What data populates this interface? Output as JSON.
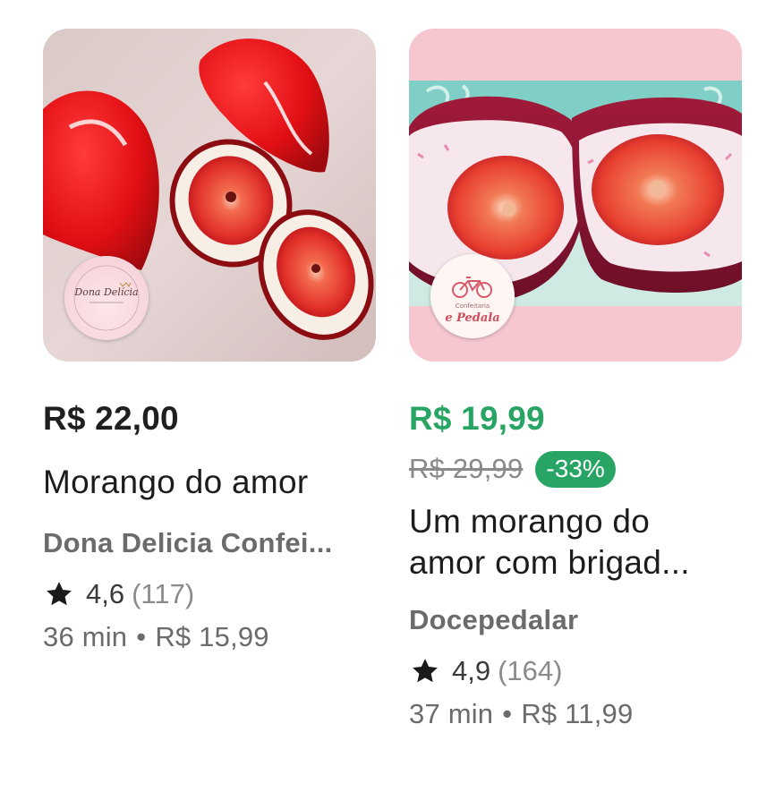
{
  "products": [
    {
      "price": "R$ 22,00",
      "title": "Morango do amor",
      "store": "Dona Delicia Confei...",
      "rating": "4,6",
      "rating_count": "(117)",
      "time": "36 min",
      "separator": "•",
      "delivery_fee": "R$ 15,99",
      "logo_text": "Dona Delícia"
    },
    {
      "price": "R$ 19,99",
      "old_price": "R$ 29,99",
      "discount": "-33%",
      "title_line1": "Um morango do",
      "title_line2": "amor com brigad...",
      "store": "Docepedalar",
      "rating": "4,9",
      "rating_count": "(164)",
      "time": "37 min",
      "separator": "•",
      "delivery_fee": "R$ 11,99",
      "logo_text_small": "Confeitaria",
      "logo_text": "e Pedala"
    }
  ],
  "colors": {
    "discount_green": "#28a564",
    "muted_text": "#6b6b6b",
    "strawberry_red": "#e41218"
  },
  "icons": {
    "rating": "star-icon"
  }
}
